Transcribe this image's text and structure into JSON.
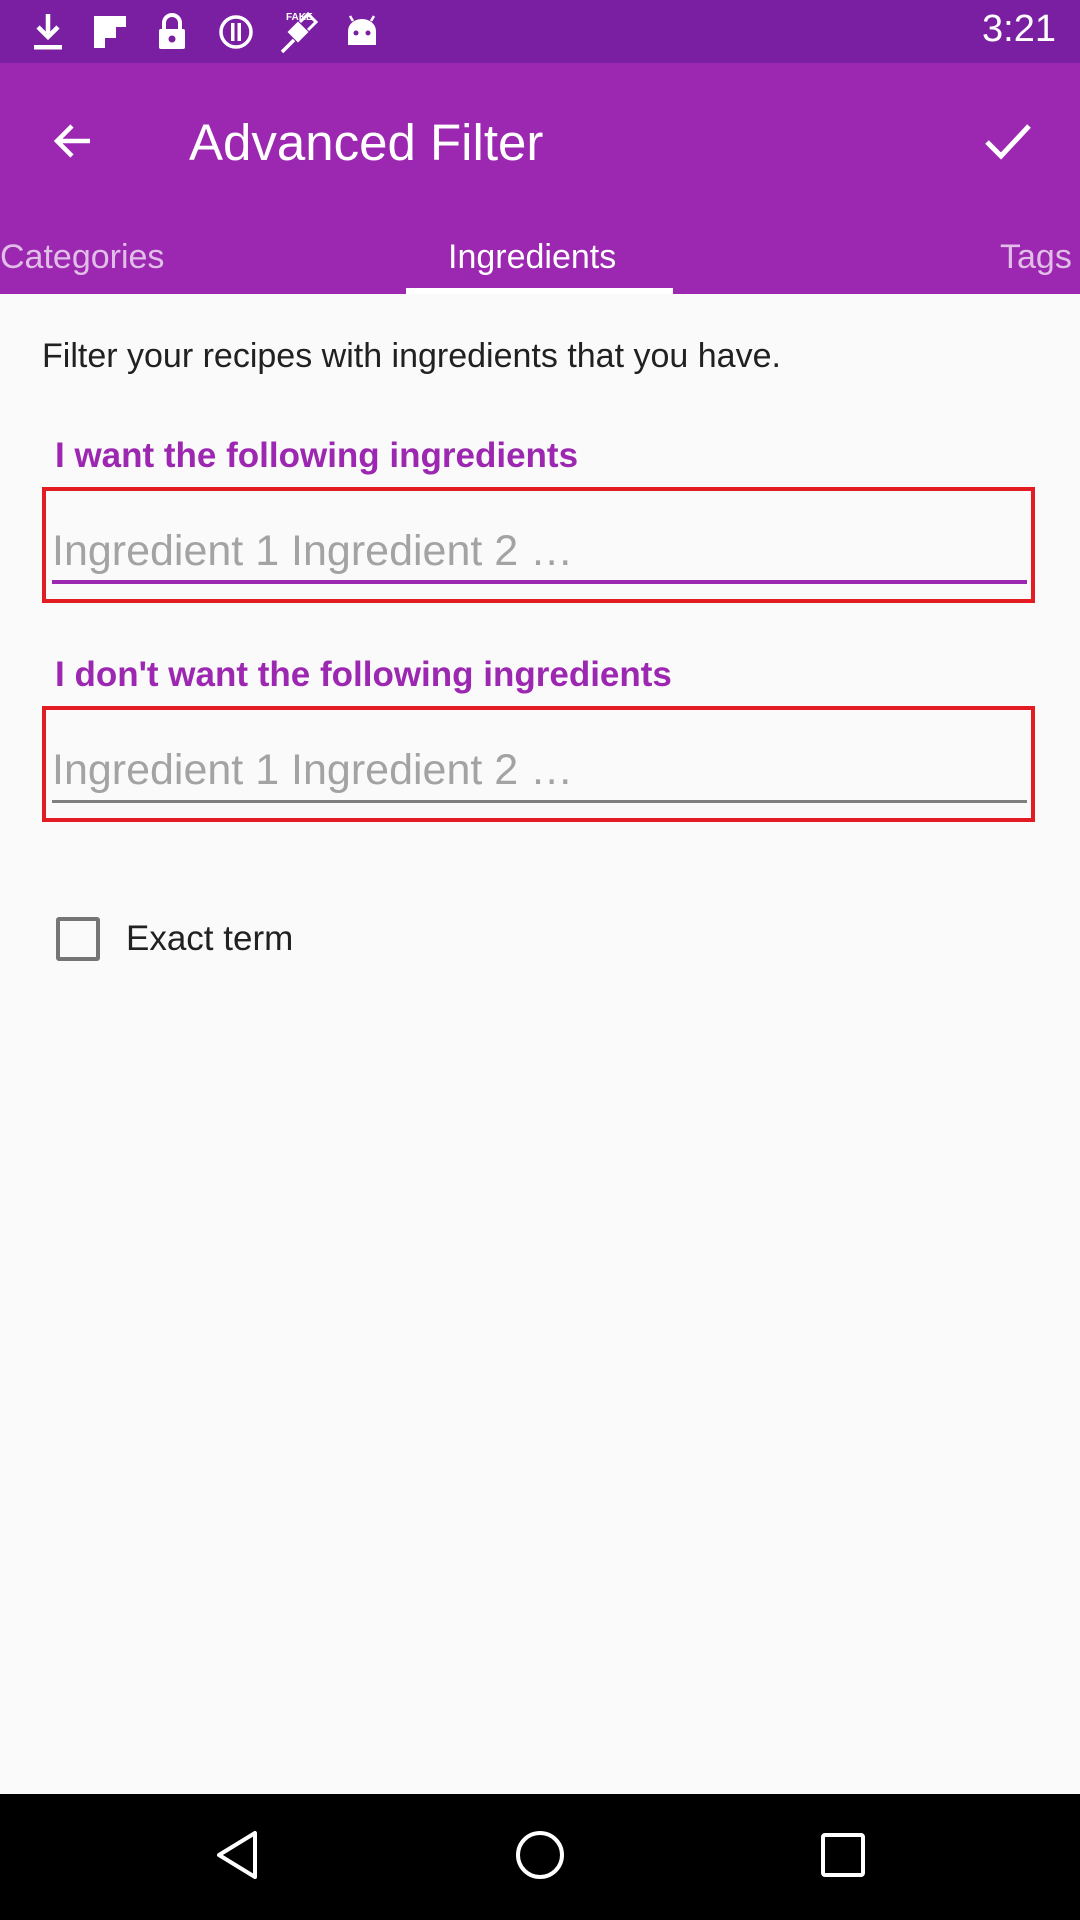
{
  "status_bar": {
    "time": "3:21",
    "icons": [
      "download-icon",
      "flipboard-icon",
      "lock-icon",
      "alert-circle-icon",
      "satellite-fake-gps-icon",
      "android-icon"
    ]
  },
  "app_bar": {
    "title": "Advanced Filter",
    "back_icon": "arrow-back-icon",
    "confirm_icon": "check-icon",
    "color": "#9c27b0",
    "status_color": "#7b1fa2"
  },
  "tabs": [
    {
      "label": "Categories",
      "active": false
    },
    {
      "label": "Ingredients",
      "active": true
    },
    {
      "label": "Tags",
      "active": false
    }
  ],
  "content": {
    "intro": "Filter your recipes with ingredients that you have.",
    "include_field": {
      "label": "I want the following ingredients",
      "value": "",
      "placeholder": "Ingredient 1 Ingredient 2 …"
    },
    "exclude_field": {
      "label": "I don't want the following ingredients",
      "value": "",
      "placeholder": "Ingredient 1 Ingredient 2 …"
    },
    "exact_term": {
      "label": "Exact term",
      "checked": false
    }
  },
  "nav_bar": {
    "icons": [
      "nav-back-icon",
      "nav-home-icon",
      "nav-recents-icon"
    ]
  }
}
